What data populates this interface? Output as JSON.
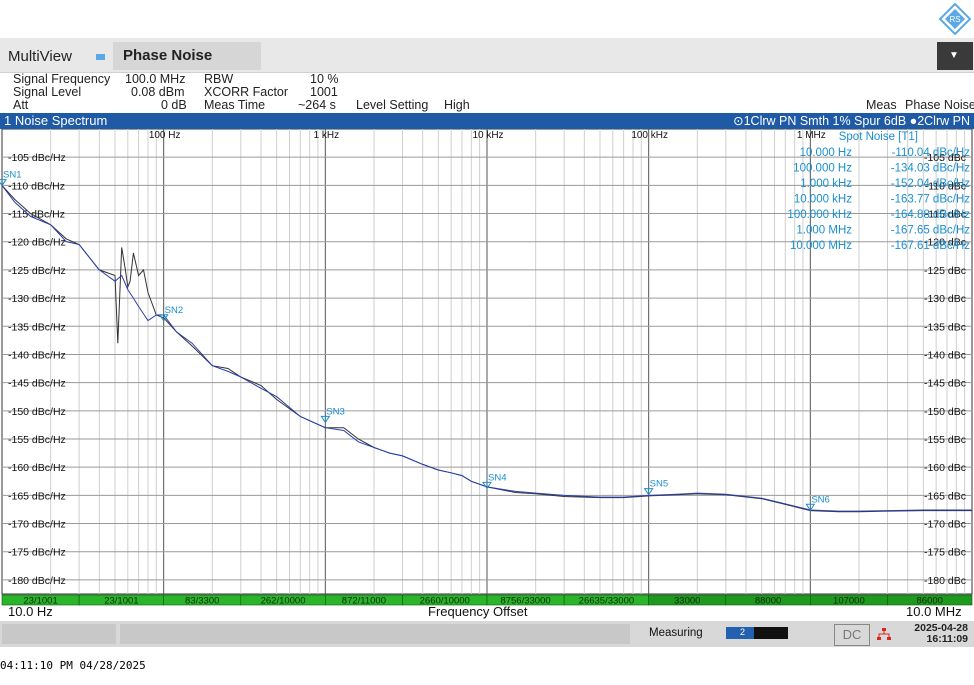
{
  "app": {
    "tab_multiview": "MultiView",
    "tab_phase_noise": "Phase Noise",
    "menu_icon": "menu-triangle-icon"
  },
  "params": {
    "signal_frequency_label": "Signal Frequency",
    "signal_frequency_value": "100.0 MHz",
    "signal_level_label": "Signal Level",
    "signal_level_value": "0.08 dBm",
    "att_label": "Att",
    "att_value": "0 dB",
    "rbw_label": "RBW",
    "rbw_value": "10 %",
    "xcorr_label": "XCORR Factor",
    "xcorr_value": "1001",
    "meas_time_label": "Meas Time",
    "meas_time_value": "~264 s",
    "level_setting_label": "Level Setting",
    "level_setting_value": "High",
    "meas_label": "Meas",
    "meas_value": "Phase Noise"
  },
  "panel": {
    "title": "1 Noise Spectrum",
    "traces_label": "1Clrw PN Smth 1% Spur 6dB",
    "trace2_label": "2Clrw PN"
  },
  "chart_data": {
    "type": "line",
    "x_scale": "log",
    "xlim": [
      10,
      10000000
    ],
    "ylim": [
      -182.5,
      -100
    ],
    "x_ticks": [
      {
        "value": 100,
        "label": "100 Hz"
      },
      {
        "value": 1000,
        "label": "1 kHz"
      },
      {
        "value": 10000,
        "label": "10 kHz"
      },
      {
        "value": 100000,
        "label": "100 kHz"
      },
      {
        "value": 1000000,
        "label": "1 MHz"
      }
    ],
    "y_ticks_left": [
      {
        "value": -105,
        "label": "-105 dBc/Hz"
      },
      {
        "value": -110,
        "label": "-110 dBc/Hz"
      },
      {
        "value": -115,
        "label": "-115 dBc/Hz"
      },
      {
        "value": -120,
        "label": "-120 dBc/Hz"
      },
      {
        "value": -125,
        "label": "-125 dBc/Hz"
      },
      {
        "value": -130,
        "label": "-130 dBc/Hz"
      },
      {
        "value": -135,
        "label": "-135 dBc/Hz"
      },
      {
        "value": -140,
        "label": "-140 dBc/Hz"
      },
      {
        "value": -145,
        "label": "-145 dBc/Hz"
      },
      {
        "value": -150,
        "label": "-150 dBc/Hz"
      },
      {
        "value": -155,
        "label": "-155 dBc/Hz"
      },
      {
        "value": -160,
        "label": "-160 dBc/Hz"
      },
      {
        "value": -165,
        "label": "-165 dBc/Hz"
      },
      {
        "value": -170,
        "label": "-170 dBc/Hz"
      },
      {
        "value": -175,
        "label": "-175 dBc/Hz"
      },
      {
        "value": -180,
        "label": "-180 dBc/Hz"
      }
    ],
    "y_ticks_right": [
      {
        "value": -105,
        "label": "-105 dBc"
      },
      {
        "value": -110,
        "label": "-110 dBc"
      },
      {
        "value": -115,
        "label": "-115 dBc"
      },
      {
        "value": -120,
        "label": "-120 dBc"
      },
      {
        "value": -125,
        "label": "-125 dBc"
      },
      {
        "value": -130,
        "label": "-130 dBc"
      },
      {
        "value": -135,
        "label": "-135 dBc"
      },
      {
        "value": -140,
        "label": "-140 dBc"
      },
      {
        "value": -145,
        "label": "-145 dBc"
      },
      {
        "value": -150,
        "label": "-150 dBc"
      },
      {
        "value": -155,
        "label": "-155 dBc"
      },
      {
        "value": -160,
        "label": "-160 dBc"
      },
      {
        "value": -165,
        "label": "-165 dBc"
      },
      {
        "value": -170,
        "label": "-170 dBc"
      },
      {
        "value": -175,
        "label": "-175 dBc"
      },
      {
        "value": -180,
        "label": "-180 dBc"
      }
    ],
    "series": [
      {
        "color": "#2a3fb0",
        "x": [
          10,
          12,
          15,
          20,
          25,
          30,
          40,
          50,
          55,
          60,
          65,
          70,
          80,
          90,
          100,
          120,
          150,
          200,
          250,
          300,
          400,
          500,
          700,
          1000,
          1300,
          1600,
          2000,
          2500,
          3000,
          4000,
          5000,
          6000,
          7000,
          8000,
          10000,
          15000,
          20000,
          30000,
          50000,
          70000,
          100000,
          150000,
          200000,
          300000,
          500000,
          700000,
          1000000,
          1500000,
          2000000,
          3000000,
          5000000,
          7000000,
          10000000
        ],
        "y": [
          -110,
          -113,
          -115.5,
          -117,
          -120,
          -120.5,
          -125,
          -127,
          -126,
          -128.5,
          -130,
          -131.5,
          -134,
          -133,
          -133,
          -136,
          -138,
          -142,
          -143,
          -144,
          -146,
          -147.5,
          -151,
          -153,
          -153.5,
          -155.5,
          -156.5,
          -157.5,
          -158,
          -159.5,
          -160.5,
          -161,
          -161.5,
          -162.5,
          -163.5,
          -164.3,
          -164.6,
          -165,
          -165.3,
          -165.3,
          -165,
          -164.8,
          -164.6,
          -164.8,
          -165.5,
          -166.5,
          -167.6,
          -167.8,
          -167.8,
          -167.7,
          -167.6,
          -167.6,
          -167.6
        ]
      },
      {
        "color": "#333333",
        "x": [
          10,
          12,
          15,
          20,
          25,
          30,
          40,
          50,
          52,
          55,
          58,
          60,
          62,
          65,
          70,
          75,
          80,
          90,
          100,
          120,
          150,
          200,
          250,
          300,
          400,
          500,
          700,
          1000,
          1300,
          1600,
          2000,
          2500,
          3000,
          4000,
          5000,
          6000,
          7000,
          8000,
          10000,
          15000,
          20000,
          30000,
          50000,
          70000,
          100000,
          150000,
          200000,
          300000,
          500000,
          700000,
          1000000,
          1500000,
          2000000,
          3000000,
          5000000,
          7000000,
          10000000
        ],
        "y": [
          -110,
          -112.5,
          -115,
          -117,
          -119.5,
          -120.5,
          -125,
          -126,
          -138,
          -121,
          -125,
          -128,
          -127,
          -122,
          -126,
          -125,
          -129,
          -133,
          -133.5,
          -136,
          -138.5,
          -142,
          -142.5,
          -144,
          -145.5,
          -148,
          -151,
          -153,
          -153,
          -155,
          -156.5,
          -157.5,
          -158,
          -159.5,
          -160.5,
          -161,
          -161.5,
          -162.5,
          -163.5,
          -164.5,
          -164.7,
          -165.2,
          -165.4,
          -165.4,
          -165.1,
          -164.9,
          -164.7,
          -164.9,
          -165.6,
          -166.6,
          -167.7,
          -167.9,
          -167.9,
          -167.8,
          -167.7,
          -167.7,
          -167.7
        ]
      }
    ],
    "markers": [
      {
        "label": "SN1",
        "x": 10,
        "y": -110.04
      },
      {
        "label": "SN2",
        "x": 100,
        "y": -134.03
      },
      {
        "label": "SN3",
        "x": 1000,
        "y": -152.04
      },
      {
        "label": "SN4",
        "x": 10000,
        "y": -163.77
      },
      {
        "label": "SN5",
        "x": 100000,
        "y": -164.88
      },
      {
        "label": "SN6",
        "x": 1000000,
        "y": -167.65
      }
    ],
    "spot_noise": {
      "title": "Spot Noise [T1]",
      "rows": [
        {
          "freq": "10.000 Hz",
          "value": "-110.04 dBc/Hz"
        },
        {
          "freq": "100.000 Hz",
          "value": "-134.03 dBc/Hz"
        },
        {
          "freq": "1.000 kHz",
          "value": "-152.04 dBc/Hz"
        },
        {
          "freq": "10.000 kHz",
          "value": "-163.77 dBc/Hz"
        },
        {
          "freq": "100.000 kHz",
          "value": "-164.88 dBc/Hz"
        },
        {
          "freq": "1.000 MHz",
          "value": "-167.65 dBc/Hz"
        },
        {
          "freq": "10.000 MHz",
          "value": "-167.61 dBc/Hz"
        }
      ]
    },
    "xcorr_segments": [
      {
        "label": "23/1001",
        "from": 10,
        "to": 30
      },
      {
        "label": "23/1001",
        "from": 30,
        "to": 100
      },
      {
        "label": "83/3300",
        "from": 100,
        "to": 300
      },
      {
        "label": "262/10000",
        "from": 300,
        "to": 1000
      },
      {
        "label": "872/11000",
        "from": 1000,
        "to": 3000
      },
      {
        "label": "2660/10000",
        "from": 3000,
        "to": 10000
      },
      {
        "label": "8756/33000",
        "from": 10000,
        "to": 30000
      },
      {
        "label": "26635/33000",
        "from": 30000,
        "to": 100000
      },
      {
        "label": "33000",
        "from": 100000,
        "to": 300000
      },
      {
        "label": "88000",
        "from": 300000,
        "to": 1000000
      },
      {
        "label": "107000",
        "from": 1000000,
        "to": 3000000
      },
      {
        "label": "86000",
        "from": 3000000,
        "to": 10000000
      }
    ],
    "xlabel_start": "10.0 Hz",
    "xlabel": "Frequency Offset",
    "xlabel_end": "10.0 MHz"
  },
  "status": {
    "measuring_label": "Measuring",
    "progress_value": 0.45,
    "progress_text": "2",
    "dc_label": "DC",
    "date": "2025-04-28",
    "time": "16:11:09"
  },
  "stamp": "04:11:10 PM  04/28/2025",
  "colors": {
    "panel_blue": "#1f5aa6",
    "marker_blue": "#1a8fd0",
    "xcorr_green": "#2bb52b"
  }
}
